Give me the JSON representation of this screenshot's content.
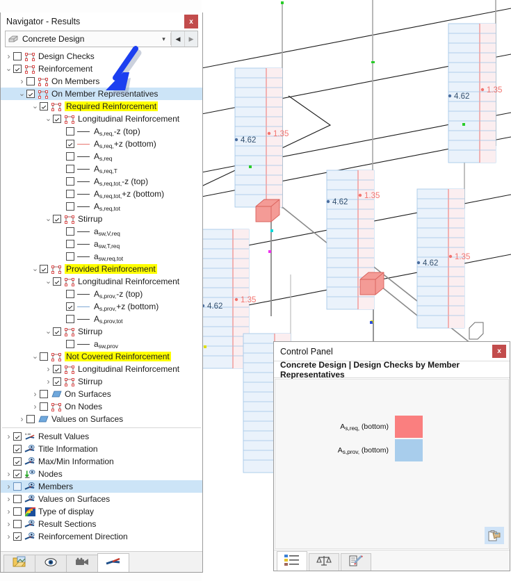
{
  "navigator": {
    "title": "Navigator - Results",
    "close_label": "x",
    "combo": {
      "value": "Concrete Design",
      "icon": "layers-icon",
      "dropdown_icon": "chevron-down-icon",
      "prev_icon": "arrow-left-icon",
      "next_icon": "arrow-right-icon"
    },
    "tree": [
      {
        "id": "design-checks",
        "indent": 0,
        "twist": ">",
        "checked": false,
        "icon": "frame-icon",
        "label": "Design Checks",
        "highlight": false,
        "selected": false
      },
      {
        "id": "reinforcement",
        "indent": 0,
        "twist": "v",
        "checked": true,
        "icon": "frame-icon",
        "label": "Reinforcement",
        "highlight": false,
        "selected": false
      },
      {
        "id": "on-members",
        "indent": 1,
        "twist": ">",
        "checked": false,
        "icon": "frame-icon",
        "label": "On Members",
        "highlight": false,
        "selected": false
      },
      {
        "id": "on-member-representatives",
        "indent": 1,
        "twist": "v",
        "checked": true,
        "icon": "frame-icon",
        "label": "On Member Representatives",
        "highlight": false,
        "selected": true
      },
      {
        "id": "required-reinforcement",
        "indent": 2,
        "twist": "v",
        "checked": true,
        "icon": "frame-icon",
        "label": "Required Reinforcement",
        "highlight": true,
        "selected": false
      },
      {
        "id": "req-longitudinal",
        "indent": 3,
        "twist": "v",
        "checked": true,
        "icon": "frame-icon",
        "label": "Longitudinal Reinforcement",
        "highlight": false,
        "selected": false
      },
      {
        "id": "as-req-mz-top",
        "indent": 4,
        "twist": "",
        "checked": false,
        "icon": "line-gray",
        "base": "A",
        "sub": "s,req,",
        "tail": "-z (top)",
        "highlight": false,
        "selected": false
      },
      {
        "id": "as-req-pz-bottom",
        "indent": 4,
        "twist": "",
        "checked": true,
        "icon": "line-red",
        "base": "A",
        "sub": "s,req,",
        "tail": "+z (bottom)",
        "highlight": false,
        "selected": false
      },
      {
        "id": "as-req",
        "indent": 4,
        "twist": "",
        "checked": false,
        "icon": "line-gray",
        "base": "A",
        "sub": "s,req",
        "tail": "",
        "highlight": false,
        "selected": false
      },
      {
        "id": "as-req-t",
        "indent": 4,
        "twist": "",
        "checked": false,
        "icon": "line-gray",
        "base": "A",
        "sub": "s,req,T",
        "tail": "",
        "highlight": false,
        "selected": false
      },
      {
        "id": "as-req-tot-mz-top",
        "indent": 4,
        "twist": "",
        "checked": false,
        "icon": "line-gray",
        "base": "A",
        "sub": "s,req,tot,",
        "tail": "-z (top)",
        "highlight": false,
        "selected": false
      },
      {
        "id": "as-req-tot-pz-bottom",
        "indent": 4,
        "twist": "",
        "checked": false,
        "icon": "line-gray",
        "base": "A",
        "sub": "s,req,tot,",
        "tail": "+z (bottom)",
        "highlight": false,
        "selected": false
      },
      {
        "id": "as-req-tot",
        "indent": 4,
        "twist": "",
        "checked": false,
        "icon": "line-gray",
        "base": "A",
        "sub": "s,req,tot",
        "tail": "",
        "highlight": false,
        "selected": false
      },
      {
        "id": "req-stirrup",
        "indent": 3,
        "twist": "v",
        "checked": true,
        "icon": "frame-icon",
        "label": "Stirrup",
        "highlight": false,
        "selected": false
      },
      {
        "id": "asw-v-req",
        "indent": 4,
        "twist": "",
        "checked": false,
        "icon": "line-gray",
        "base": "a",
        "sub": "sw,V,req",
        "tail": "",
        "highlight": false,
        "selected": false
      },
      {
        "id": "asw-t-req",
        "indent": 4,
        "twist": "",
        "checked": false,
        "icon": "line-gray",
        "base": "a",
        "sub": "sw,T,req",
        "tail": "",
        "highlight": false,
        "selected": false
      },
      {
        "id": "asw-req-tot",
        "indent": 4,
        "twist": "",
        "checked": false,
        "icon": "line-gray",
        "base": "a",
        "sub": "sw,req,tot",
        "tail": "",
        "highlight": false,
        "selected": false
      },
      {
        "id": "provided-reinforcement",
        "indent": 2,
        "twist": "v",
        "checked": true,
        "icon": "frame-icon",
        "label": "Provided Reinforcement",
        "highlight": true,
        "selected": false
      },
      {
        "id": "prov-longitudinal",
        "indent": 3,
        "twist": "v",
        "checked": true,
        "icon": "frame-icon",
        "label": "Longitudinal Reinforcement",
        "highlight": false,
        "selected": false
      },
      {
        "id": "as-prov-mz-top",
        "indent": 4,
        "twist": "",
        "checked": false,
        "icon": "line-gray",
        "base": "A",
        "sub": "s,prov,",
        "tail": "-z (top)",
        "highlight": false,
        "selected": false
      },
      {
        "id": "as-prov-pz-bottom",
        "indent": 4,
        "twist": "",
        "checked": true,
        "icon": "line-blue",
        "base": "A",
        "sub": "s,prov,",
        "tail": "+z (bottom)",
        "highlight": false,
        "selected": false
      },
      {
        "id": "as-prov-tot",
        "indent": 4,
        "twist": "",
        "checked": false,
        "icon": "line-gray",
        "base": "A",
        "sub": "s,prov,tot",
        "tail": "",
        "highlight": false,
        "selected": false
      },
      {
        "id": "prov-stirrup",
        "indent": 3,
        "twist": "v",
        "checked": true,
        "icon": "frame-icon",
        "label": "Stirrup",
        "highlight": false,
        "selected": false
      },
      {
        "id": "asw-prov",
        "indent": 4,
        "twist": "",
        "checked": false,
        "icon": "line-gray",
        "base": "a",
        "sub": "sw,prov",
        "tail": "",
        "highlight": false,
        "selected": false
      },
      {
        "id": "not-covered-reinforcement",
        "indent": 2,
        "twist": "v",
        "checked": false,
        "icon": "frame-icon",
        "label": "Not Covered Reinforcement",
        "highlight": true,
        "selected": false
      },
      {
        "id": "nc-longitudinal",
        "indent": 3,
        "twist": ">",
        "checked": true,
        "icon": "frame-icon",
        "label": "Longitudinal Reinforcement",
        "highlight": false,
        "selected": false
      },
      {
        "id": "nc-stirrup",
        "indent": 3,
        "twist": ">",
        "checked": true,
        "icon": "frame-icon",
        "label": "Stirrup",
        "highlight": false,
        "selected": false
      },
      {
        "id": "on-surfaces",
        "indent": 2,
        "twist": ">",
        "checked": false,
        "icon": "surface-icon",
        "label": "On Surfaces",
        "highlight": false,
        "selected": false
      },
      {
        "id": "on-nodes",
        "indent": 2,
        "twist": ">",
        "checked": false,
        "icon": "frame-icon",
        "label": "On Nodes",
        "highlight": false,
        "selected": false
      },
      {
        "id": "values-on-surfaces-1",
        "indent": 1,
        "twist": ">",
        "checked": false,
        "icon": "surface-icon",
        "label": "Values on Surfaces",
        "highlight": false,
        "selected": false
      }
    ],
    "tree2": [
      {
        "id": "result-values",
        "twist": ">",
        "checked": true,
        "icon": "xxx-icon",
        "label": "Result Values",
        "selected": false
      },
      {
        "id": "title-information",
        "twist": "",
        "checked": true,
        "icon": "eye-arrow-icon",
        "label": "Title Information",
        "selected": false
      },
      {
        "id": "max-min-information",
        "twist": "",
        "checked": true,
        "icon": "eye-arrow-icon",
        "label": "Max/Min Information",
        "selected": false
      },
      {
        "id": "nodes",
        "twist": ">",
        "checked": true,
        "icon": "node-arrow-icon",
        "label": "Nodes",
        "selected": false
      },
      {
        "id": "members",
        "twist": ">",
        "checked": false,
        "icon": "eye-arrow-icon",
        "label": "Members",
        "selected": true
      },
      {
        "id": "values-on-surfaces-2",
        "twist": ">",
        "checked": false,
        "icon": "eye-arrow-icon",
        "label": "Values on Surfaces",
        "selected": false
      },
      {
        "id": "type-of-display",
        "twist": ">",
        "checked": false,
        "icon": "rainbow-icon",
        "label": "Type of display",
        "selected": false
      },
      {
        "id": "result-sections",
        "twist": ">",
        "checked": false,
        "icon": "eye-arrow-icon",
        "label": "Result Sections",
        "selected": false
      },
      {
        "id": "reinforcement-direction",
        "twist": ">",
        "checked": true,
        "icon": "eye-arrow-icon",
        "label": "Reinforcement Direction",
        "selected": false
      }
    ],
    "tabs": [
      {
        "id": "project-navigator",
        "icon": "folder-image-icon",
        "active": false
      },
      {
        "id": "display-navigator",
        "icon": "eye-icon",
        "active": false
      },
      {
        "id": "views-navigator",
        "icon": "camera-icon",
        "active": false
      },
      {
        "id": "results-navigator",
        "icon": "results-icon",
        "active": true
      }
    ]
  },
  "control_panel": {
    "title": "Control Panel",
    "close_label": "x",
    "subtitle": "Concrete Design | Design Checks by Member Representatives",
    "legend": [
      {
        "id": "as-req-bottom",
        "base": "A",
        "sub": "s,req,",
        "tail": " (bottom)",
        "color": "#fa7f7f"
      },
      {
        "id": "as-prov-bottom",
        "base": "A",
        "sub": "s,prov,",
        "tail": " (bottom)",
        "color": "#a8cdec"
      }
    ],
    "copy_icon": "copy-to-clipboard-icon",
    "tabs": [
      {
        "id": "color-legend",
        "icon": "color-list-icon",
        "active": true
      },
      {
        "id": "factors",
        "icon": "scales-icon",
        "active": false
      },
      {
        "id": "display-properties",
        "icon": "edit-properties-icon",
        "active": false
      }
    ]
  },
  "viewport": {
    "labels_required": [
      "1.35",
      "1.35",
      "1.35",
      "1.35",
      "1.35"
    ],
    "labels_provided": [
      "4.62",
      "4.62",
      "4.62",
      "4.62",
      "4.62"
    ],
    "value_required": "1.35",
    "value_provided": "4.62",
    "colors": {
      "required": "#f2736e",
      "provided": "#9dc3e6",
      "member": "#808080",
      "edge": "#1a1a1a"
    }
  },
  "annotation": {
    "arrow_icon": "blue-arrow-annotation",
    "color": "#1c3ff0"
  }
}
